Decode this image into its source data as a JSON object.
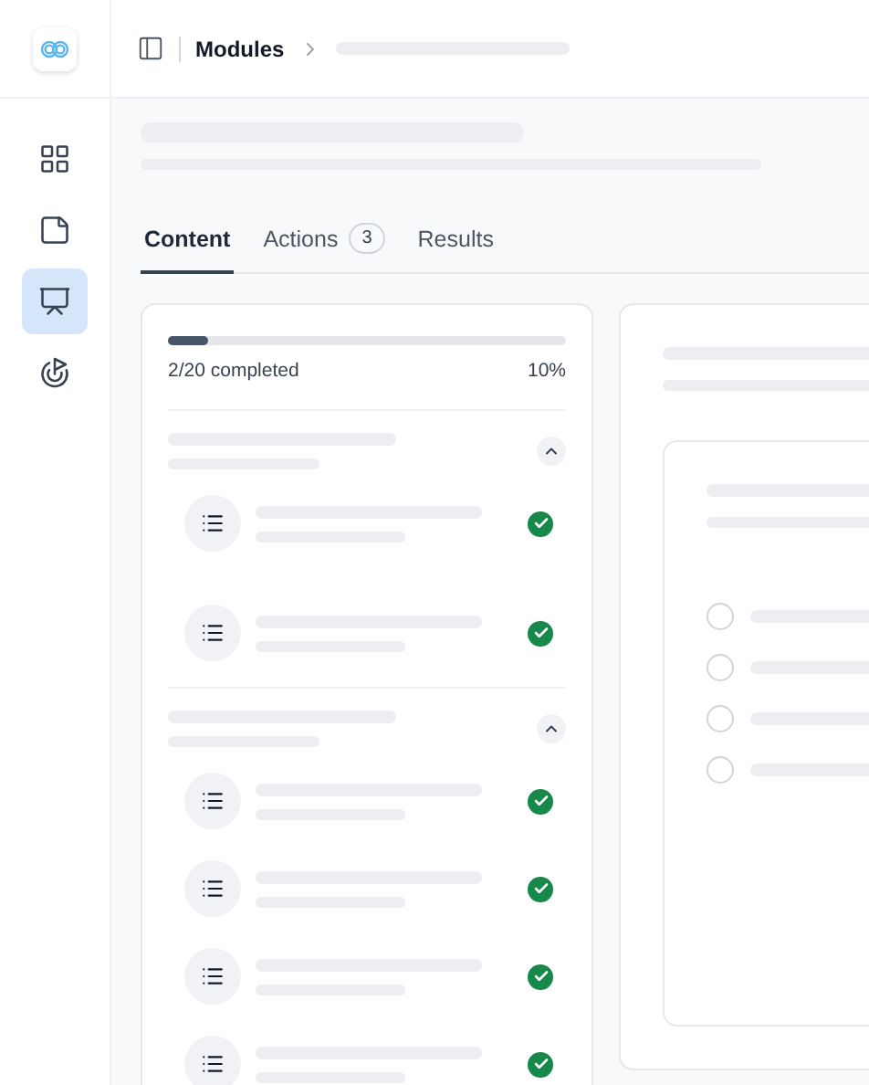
{
  "nav": [
    {
      "kind": "dashboard",
      "selected": false
    },
    {
      "kind": "notes",
      "selected": false
    },
    {
      "kind": "presentation",
      "selected": true
    },
    {
      "kind": "goals",
      "selected": false
    }
  ],
  "breadcrumb": {
    "current": "Modules"
  },
  "tabs": [
    {
      "label": "Content",
      "selected": true
    },
    {
      "label": "Actions",
      "badge": "3",
      "selected": false
    },
    {
      "label": "Results",
      "selected": false
    }
  ],
  "progress": {
    "level": 0.1,
    "summary": "2/20 completed",
    "percent": "10%"
  },
  "sections": [
    {
      "expanded": true,
      "items": [
        {
          "done": true
        },
        {
          "done": true
        }
      ]
    },
    {
      "expanded": true,
      "items": [
        {
          "done": true
        },
        {
          "done": true
        },
        {
          "done": true
        },
        {
          "done": true
        }
      ]
    }
  ],
  "question": {
    "options": [
      {
        "selected": false
      },
      {
        "selected": false
      },
      {
        "selected": false
      },
      {
        "selected": false
      }
    ]
  }
}
